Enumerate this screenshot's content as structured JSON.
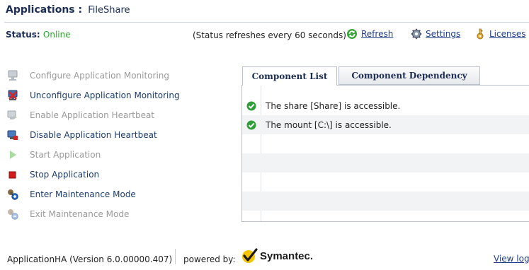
{
  "header": {
    "title_label": "Applications :",
    "app_name": "FileShare"
  },
  "status": {
    "label": "Status:",
    "value": "Online",
    "refresh_note": "(Status refreshes every 60 seconds)",
    "online_color": "#2ea52e"
  },
  "toolbar": {
    "refresh_label": "Refresh",
    "settings_label": "Settings",
    "licenses_label": "Licenses"
  },
  "actions": [
    {
      "label": "Configure Application Monitoring",
      "enabled": false,
      "icon": "configure-icon"
    },
    {
      "label": "Unconfigure Application Monitoring",
      "enabled": true,
      "icon": "unconfigure-icon"
    },
    {
      "label": "Enable Application Heartbeat",
      "enabled": false,
      "icon": "heartbeat-enable-icon"
    },
    {
      "label": "Disable Application Heartbeat",
      "enabled": true,
      "icon": "heartbeat-disable-icon"
    },
    {
      "label": "Start Application",
      "enabled": false,
      "icon": "play-icon"
    },
    {
      "label": "Stop Application",
      "enabled": true,
      "icon": "stop-icon"
    },
    {
      "label": "Enter Maintenance Mode",
      "enabled": true,
      "icon": "maintenance-enter-icon"
    },
    {
      "label": "Exit Maintenance Mode",
      "enabled": false,
      "icon": "maintenance-exit-icon"
    }
  ],
  "tabs": [
    {
      "label": "Component List",
      "active": true
    },
    {
      "label": "Component Dependency",
      "active": false
    }
  ],
  "components": [
    {
      "status": "ok",
      "text": "The share [Share] is accessible."
    },
    {
      "status": "ok",
      "text": "The mount [C:\\] is accessible."
    }
  ],
  "footer": {
    "version": "ApplicationHA (Version 6.0.00000.407)",
    "powered_by": "powered by:",
    "brand": "Symantec.",
    "view_log": "View log"
  }
}
